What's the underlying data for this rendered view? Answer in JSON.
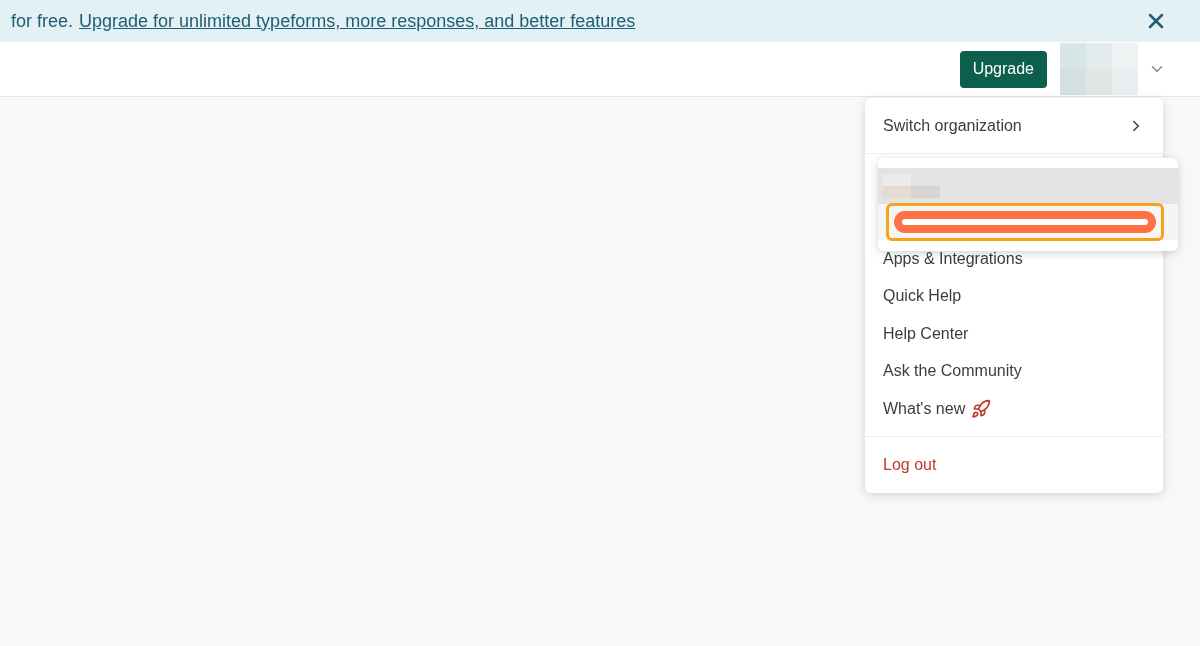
{
  "banner": {
    "lead_text": "for free.",
    "link": "Upgrade for unlimited typeforms, more responses, and better features"
  },
  "header": {
    "upgrade_button": "Upgrade"
  },
  "menu": {
    "switch_item": "Switch organization",
    "items": [
      {
        "label": "Apps & Integrations",
        "kind": "plain"
      },
      {
        "label": "Quick Help",
        "kind": "plain"
      },
      {
        "label": "Help Center",
        "kind": "plain"
      },
      {
        "label": "Ask the Community",
        "kind": "plain"
      },
      {
        "label": "What's new",
        "kind": "rocket"
      }
    ],
    "logout": "Log out"
  },
  "submenu": {
    "rows": [
      {
        "selected": true
      },
      {
        "selected": false,
        "highlighted": true
      }
    ]
  }
}
